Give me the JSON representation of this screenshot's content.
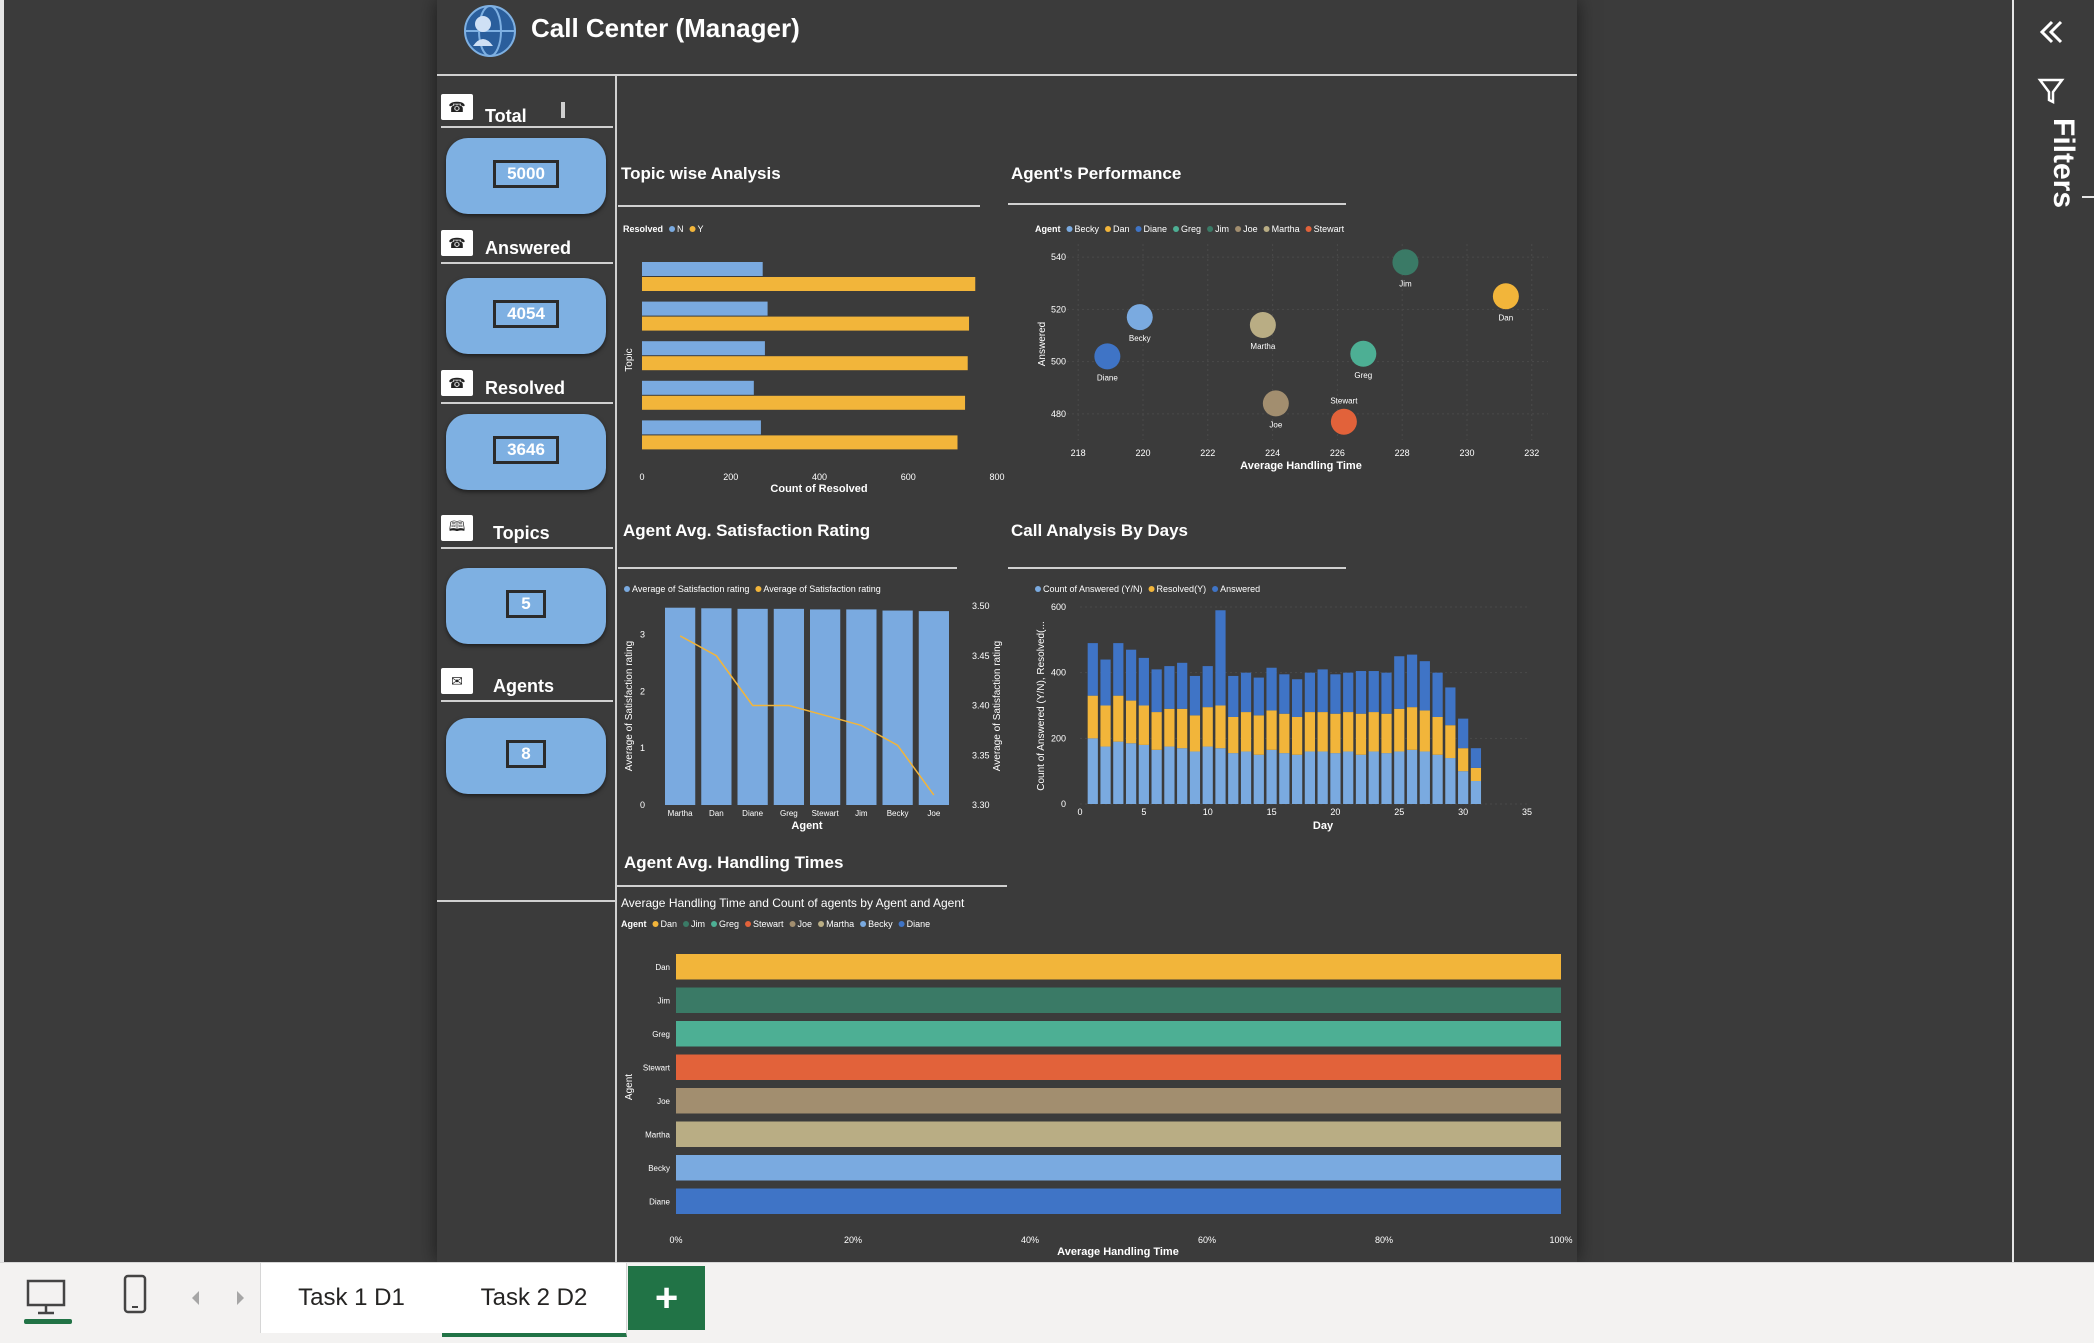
{
  "report": {
    "title": "Call Center (Manager)"
  },
  "kpis": [
    {
      "label": "Total",
      "value": "5000",
      "icon": "phone-icon"
    },
    {
      "label": "Answered",
      "value": "4054",
      "icon": "phone-icon"
    },
    {
      "label": "Resolved",
      "value": "3646",
      "icon": "phone-icon"
    },
    {
      "label": "Topics",
      "value": "5",
      "icon": "book-icon"
    },
    {
      "label": "Agents",
      "value": "8",
      "icon": "chat-bubble-icon"
    }
  ],
  "colors": {
    "background": "#3b3b3b",
    "kpi_card": "#7eb0e2",
    "light_blue": "#7aaae0",
    "yellow": "#f2b53a",
    "dark_blue": "#3f74c6",
    "accent_green": "#217346"
  },
  "filters": {
    "label": "Filters"
  },
  "pages": [
    {
      "label": "Task 1 D1",
      "active": false
    },
    {
      "label": "Task 2 D2",
      "active": true
    }
  ],
  "chart_data": [
    {
      "id": "topic",
      "type": "bar",
      "title": "Topic wise Analysis",
      "legend_title": "Resolved",
      "xlabel": "Count of Resolved",
      "ylabel": "Topic",
      "xlim": [
        0,
        800
      ],
      "xticks": [
        "0",
        "200",
        "400",
        "600",
        "800"
      ],
      "series": [
        {
          "name": "N",
          "color": "#7aaae0",
          "values": [
            272,
            283,
            277,
            252,
            268
          ]
        },
        {
          "name": "Y",
          "color": "#f2b53a",
          "values": [
            751,
            737,
            734,
            728,
            711
          ]
        }
      ]
    },
    {
      "id": "perf",
      "type": "scatter",
      "title": "Agent's Performance",
      "legend_title": "Agent",
      "xlabel": "Average Handling Time",
      "ylabel": "Answered",
      "xlim": [
        217.5,
        232.5
      ],
      "ylim": [
        470,
        545
      ],
      "xticks": [
        "218",
        "220",
        "222",
        "224",
        "226",
        "228",
        "230",
        "232"
      ],
      "yticks": [
        "480",
        "500",
        "520",
        "540"
      ],
      "legend": [
        {
          "name": "Becky",
          "color": "#7aaae0"
        },
        {
          "name": "Dan",
          "color": "#f2b53a"
        },
        {
          "name": "Diane",
          "color": "#3f74c6"
        },
        {
          "name": "Greg",
          "color": "#4daf94"
        },
        {
          "name": "Jim",
          "color": "#3a7a66"
        },
        {
          "name": "Joe",
          "color": "#a28e6f"
        },
        {
          "name": "Martha",
          "color": "#b9ad84"
        },
        {
          "name": "Stewart",
          "color": "#e2623a"
        }
      ],
      "points": [
        {
          "name": "Jim",
          "x": 228.1,
          "y": 538,
          "color": "#3a7a66"
        },
        {
          "name": "Dan",
          "x": 231.2,
          "y": 525,
          "color": "#f2b53a"
        },
        {
          "name": "Becky",
          "x": 219.9,
          "y": 517,
          "color": "#7aaae0"
        },
        {
          "name": "Martha",
          "x": 223.7,
          "y": 514,
          "color": "#b9ad84"
        },
        {
          "name": "Diane",
          "x": 218.9,
          "y": 502,
          "color": "#3f74c6"
        },
        {
          "name": "Greg",
          "x": 226.8,
          "y": 503,
          "color": "#4daf94"
        },
        {
          "name": "Joe",
          "x": 224.1,
          "y": 484,
          "color": "#a28e6f"
        },
        {
          "name": "Stewart",
          "x": 226.2,
          "y": 477,
          "color": "#e2623a"
        }
      ]
    },
    {
      "id": "sat",
      "type": "bar",
      "title": "Agent Avg. Satisfaction Rating",
      "xlabel": "Agent",
      "ylabel": "Average of Satisfaction rating",
      "y2label": "Average of Satisfaction rating",
      "legend": [
        {
          "name": "Average of Satisfaction rating",
          "color": "#7aaae0"
        },
        {
          "name": "Average of Satisfaction rating",
          "color": "#f2b53a"
        }
      ],
      "categories": [
        "Martha",
        "Dan",
        "Diane",
        "Greg",
        "Stewart",
        "Jim",
        "Becky",
        "Joe"
      ],
      "ylim": [
        0,
        3.5
      ],
      "yticks": [
        "0",
        "1",
        "2",
        "3"
      ],
      "y2lim": [
        3.3,
        3.5
      ],
      "y2ticks": [
        "3.30",
        "3.35",
        "3.40",
        "3.45",
        "3.50"
      ],
      "bars": [
        3.47,
        3.46,
        3.45,
        3.45,
        3.44,
        3.44,
        3.42,
        3.41
      ],
      "line": [
        3.47,
        3.45,
        3.4,
        3.4,
        3.39,
        3.38,
        3.36,
        3.31
      ]
    },
    {
      "id": "days",
      "type": "bar",
      "stacked": true,
      "title": "Call Analysis By Days",
      "xlabel": "Day",
      "ylabel": "Count of Answered (Y/N), Resolved(...",
      "legend": [
        {
          "name": "Count of Answered (Y/N)",
          "color": "#7aaae0"
        },
        {
          "name": "Resolved(Y)",
          "color": "#f2b53a"
        },
        {
          "name": "Answered",
          "color": "#3f74c6"
        }
      ],
      "xlim": [
        0,
        35
      ],
      "ylim": [
        0,
        600
      ],
      "xticks": [
        "0",
        "5",
        "10",
        "15",
        "20",
        "25",
        "30",
        "35"
      ],
      "yticks": [
        "0",
        "200",
        "400",
        "600"
      ],
      "days": [
        1,
        2,
        3,
        4,
        5,
        6,
        7,
        8,
        9,
        10,
        11,
        12,
        13,
        14,
        15,
        16,
        17,
        18,
        19,
        20,
        21,
        22,
        23,
        24,
        25,
        26,
        27,
        28,
        29,
        30,
        31
      ],
      "series": [
        {
          "name": "Count of Answered (Y/N)",
          "color": "#7aaae0",
          "values": [
            200,
            175,
            190,
            185,
            180,
            165,
            175,
            170,
            160,
            175,
            170,
            155,
            160,
            150,
            165,
            155,
            150,
            160,
            160,
            155,
            160,
            150,
            160,
            155,
            160,
            165,
            160,
            150,
            140,
            100,
            70
          ]
        },
        {
          "name": "Resolved(Y)",
          "color": "#f2b53a",
          "values": [
            130,
            125,
            140,
            130,
            120,
            115,
            115,
            120,
            110,
            120,
            130,
            110,
            120,
            120,
            120,
            120,
            115,
            120,
            120,
            120,
            120,
            125,
            120,
            120,
            130,
            130,
            125,
            115,
            100,
            70,
            40
          ]
        },
        {
          "name": "Answered",
          "color": "#3f74c6",
          "values": [
            160,
            140,
            160,
            155,
            145,
            130,
            130,
            140,
            120,
            125,
            290,
            125,
            120,
            115,
            130,
            120,
            115,
            120,
            130,
            120,
            120,
            130,
            125,
            125,
            160,
            160,
            150,
            135,
            115,
            90,
            60
          ]
        }
      ]
    },
    {
      "id": "aht",
      "type": "bar",
      "stacked": true,
      "title": "Agent Avg. Handling Times",
      "subtitle": "Average Handling Time and Count of agents by Agent and Agent",
      "legend_title": "Agent",
      "legend": [
        {
          "name": "Dan",
          "color": "#f2b53a"
        },
        {
          "name": "Jim",
          "color": "#3a7a66"
        },
        {
          "name": "Greg",
          "color": "#4daf94"
        },
        {
          "name": "Stewart",
          "color": "#e2623a"
        },
        {
          "name": "Joe",
          "color": "#a28e6f"
        },
        {
          "name": "Martha",
          "color": "#b9ad84"
        },
        {
          "name": "Becky",
          "color": "#7aaae0"
        },
        {
          "name": "Diane",
          "color": "#3f74c6"
        }
      ],
      "xlabel": "Average Handling Time",
      "ylabel": "Agent",
      "xticks": [
        "0%",
        "20%",
        "40%",
        "60%",
        "80%",
        "100%"
      ],
      "categories": [
        "Dan",
        "Jim",
        "Greg",
        "Stewart",
        "Joe",
        "Martha",
        "Becky",
        "Diane"
      ],
      "values": [
        1,
        1,
        1,
        1,
        1,
        1,
        1,
        1
      ]
    }
  ]
}
